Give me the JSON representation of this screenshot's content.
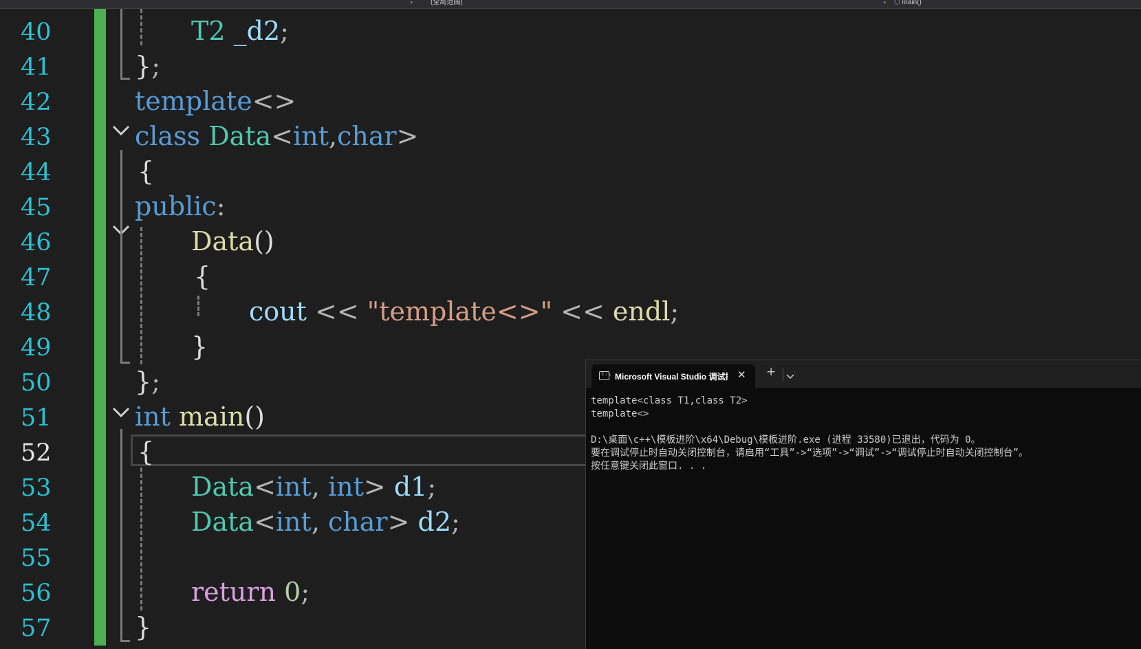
{
  "nav_bar": {
    "scope_dropdown": "(全局范围)",
    "member_dropdown": "main()",
    "member_icon": "cube-icon"
  },
  "editor": {
    "line_numbers": [
      "40",
      "41",
      "42",
      "43",
      "44",
      "45",
      "46",
      "47",
      "48",
      "49",
      "50",
      "51",
      "52",
      "53",
      "54",
      "55",
      "56",
      "57"
    ],
    "current_line": "52",
    "code": {
      "l40": {
        "type": "T2",
        "var": "_d2",
        "semi": ";"
      },
      "l41": {
        "brace": "}",
        "semi": ";"
      },
      "l42": {
        "kw": "template",
        "angles": "<>"
      },
      "l43": {
        "kw_class": "class",
        "name": "Data",
        "lt": "<",
        "t1": "int",
        "comma": ",",
        "t2": "char",
        "gt": ">"
      },
      "l44": {
        "brace": "{"
      },
      "l45": {
        "kw": "public",
        "colon": ":"
      },
      "l46": {
        "fn": "Data",
        "parens": "()"
      },
      "l47": {
        "brace": "{"
      },
      "l48": {
        "obj": "cout",
        "op1": " << ",
        "str": "\"template<>\"",
        "op2": " << ",
        "endl": "endl",
        "semi": ";"
      },
      "l49": {
        "brace": "}"
      },
      "l50": {
        "brace": "}",
        "semi": ";"
      },
      "l51": {
        "kw": "int",
        "fn": "main",
        "parens": "()"
      },
      "l52": {
        "brace": "{"
      },
      "l53": {
        "type": "Data",
        "lt": "<",
        "t1": "int",
        "comma": ", ",
        "t2": "int",
        "gt": ">",
        "var": "d1",
        "semi": ";"
      },
      "l54": {
        "type": "Data",
        "lt": "<",
        "t1": "int",
        "comma": ", ",
        "t2": "char",
        "gt": ">",
        "var": "d2",
        "semi": ";"
      },
      "l56": {
        "kw": "return",
        "num": "0",
        "semi": ";"
      },
      "l57": {
        "brace": "}"
      }
    },
    "colors": {
      "keyword": "#569cd6",
      "type": "#4ec9b0",
      "function": "#dcdcaa",
      "string": "#d69d85",
      "number": "#b5cea8",
      "variable": "#9cdcfe",
      "control": "#d8a0df",
      "line_number": "#2bc2d3",
      "change_bar": "#4caf50"
    }
  },
  "terminal": {
    "tab_title": "Microsoft Visual Studio 调试控制台",
    "tab_icon": "terminal-icon",
    "close_icon": "close-icon",
    "new_tab_icon": "plus-icon",
    "dropdown_icon": "chevron-down-icon",
    "lines": [
      "template<class T1,class T2>",
      "template<>",
      "",
      "D:\\桌面\\c++\\模板进阶\\x64\\Debug\\模板进阶.exe (进程 33580)已退出，代码为 0。",
      "要在调试停止时自动关闭控制台，请启用“工具”->“选项”->“调试”->“调试停止时自动关闭控制台”。",
      "按任意键关闭此窗口. . ."
    ]
  }
}
